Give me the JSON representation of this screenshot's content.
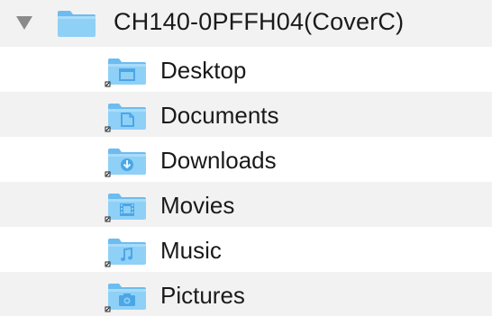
{
  "root": {
    "label": "CH140-0PFFH04(CoverC)",
    "expanded": true,
    "icon": "folder-icon"
  },
  "items": [
    {
      "label": "Desktop",
      "icon": "desktop-folder-icon"
    },
    {
      "label": "Documents",
      "icon": "documents-folder-icon"
    },
    {
      "label": "Downloads",
      "icon": "downloads-folder-icon"
    },
    {
      "label": "Movies",
      "icon": "movies-folder-icon"
    },
    {
      "label": "Music",
      "icon": "music-folder-icon"
    },
    {
      "label": "Pictures",
      "icon": "pictures-folder-icon"
    }
  ],
  "colors": {
    "folder_light": "#8fd0f7",
    "folder_dark": "#4aa7e6",
    "glyph": "#e8f5fe",
    "alt_row": "#f2f2f2",
    "disclosure": "#8a8a8a"
  }
}
